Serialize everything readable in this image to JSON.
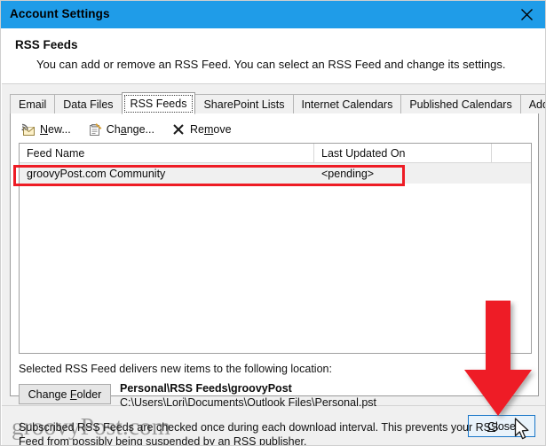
{
  "window": {
    "title": "Account Settings",
    "close_icon": "close-x-icon",
    "accent_color": "#1f9ce8"
  },
  "header": {
    "title": "RSS Feeds",
    "description": "You can add or remove an RSS Feed. You can select an RSS Feed and change its settings."
  },
  "tabs": [
    {
      "label": "Email",
      "selected": false
    },
    {
      "label": "Data Files",
      "selected": false
    },
    {
      "label": "RSS Feeds",
      "selected": true
    },
    {
      "label": "SharePoint Lists",
      "selected": false
    },
    {
      "label": "Internet Calendars",
      "selected": false
    },
    {
      "label": "Published Calendars",
      "selected": false
    },
    {
      "label": "Address Books",
      "selected": false
    }
  ],
  "toolbar": {
    "new_label": "New...",
    "new_label_pre": "",
    "new_accel": "N",
    "new_label_post": "ew...",
    "new_icon": "new-rss-feed-icon",
    "change_label_pre": "Ch",
    "change_accel": "a",
    "change_label_post": "nge...",
    "change_icon": "change-rss-feed-icon",
    "remove_label_pre": "Re",
    "remove_accel": "m",
    "remove_label_post": "ove",
    "remove_icon": "remove-x-icon"
  },
  "listview": {
    "columns": [
      "Feed Name",
      "Last Updated On",
      ""
    ],
    "rows": [
      {
        "feed_name": "groovyPost.com Community",
        "last_updated_on": "<pending>",
        "selected": true
      }
    ]
  },
  "location": {
    "label": "Selected RSS Feed delivers new items to the following location:",
    "change_folder_pre": "Change ",
    "change_folder_accel": "F",
    "change_folder_post": "older",
    "folder_path": "Personal\\RSS Feeds\\groovyPost",
    "file_path": "C:\\Users\\Lori\\Documents\\Outlook Files\\Personal.pst"
  },
  "note": "Subscribed RSS Feeds are checked once during each download interval. This prevents your RSS Feed from possibly being suspended by an RSS publisher.",
  "footer": {
    "watermark": "groovyPost.com",
    "close_pre": "",
    "close_accel": "C",
    "close_post": "lose"
  },
  "annotations": {
    "highlight_color": "#ee1c25",
    "arrow_color": "#ee1c25",
    "highlight_target": "groovyPost.com Community",
    "arrow_target": "Close"
  }
}
